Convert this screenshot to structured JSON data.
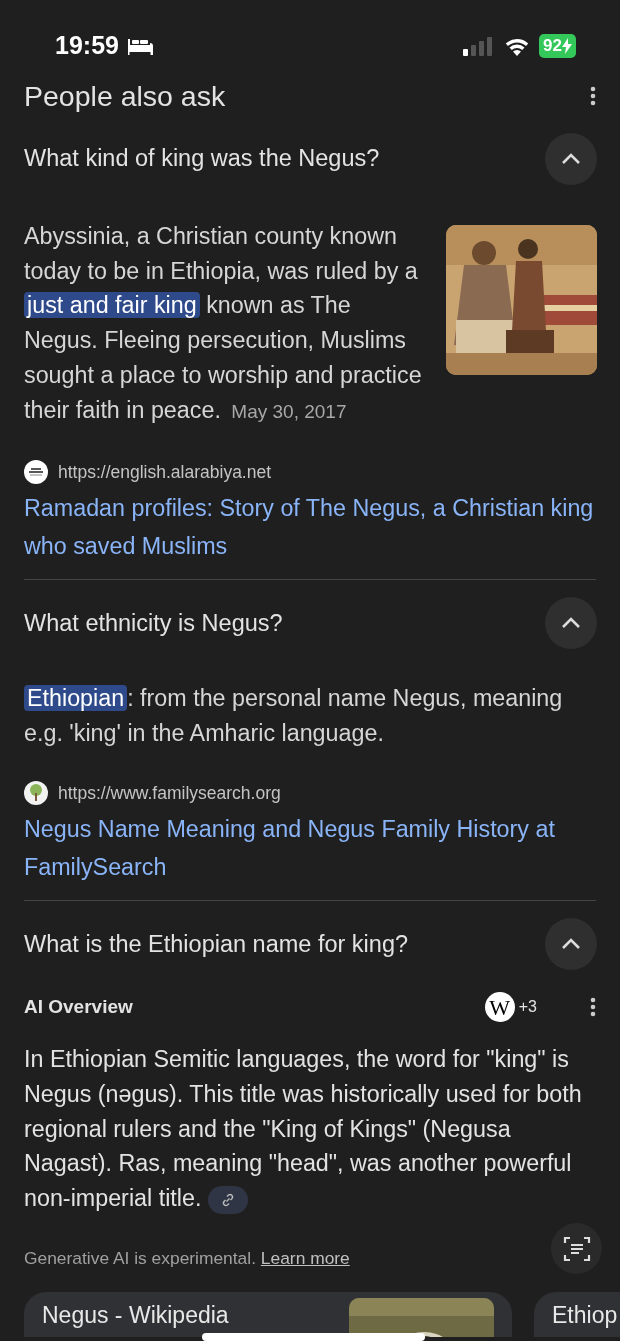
{
  "status_bar": {
    "time": "19:59",
    "battery": "92",
    "charging": true
  },
  "header": {
    "title": "People also ask"
  },
  "questions": [
    {
      "kind": "answer",
      "question": "What kind of king was the Negus?",
      "expanded": true,
      "segments": [
        {
          "text": "Abyssinia, a Christian county known today to be in Ethiopia, was ruled by a ",
          "highlighted": false
        },
        {
          "text": "just and fair king",
          "highlighted": true
        },
        {
          "text": " known as The Negus. Fleeing persecution, Muslims sought a place to worship and practice their faith in peace.",
          "highlighted": false
        }
      ],
      "date": "May 30, 2017",
      "source": {
        "url": "https://english.alarabiya.net",
        "title": "Ramadan profiles: Story of The Negus, a Christian king who saved Muslims"
      }
    },
    {
      "kind": "answer",
      "question": "What ethnicity is Negus?",
      "expanded": true,
      "segments": [
        {
          "text": "Ethiopian",
          "highlighted": true
        },
        {
          "text": ": from the personal name Negus, meaning e.g. 'king' in the Amharic language.",
          "highlighted": false
        }
      ],
      "source": {
        "url": "https://www.familysearch.org",
        "title": "Negus Name Meaning and Negus Family History at FamilySearch"
      }
    },
    {
      "kind": "ai_overview",
      "question": "What is the Ethiopian name for king?",
      "expanded": true,
      "label": "AI Overview",
      "logo": "W",
      "more_sources": "+3",
      "text": "In Ethiopian Semitic languages, the word for \"king\" is Negus (nəgus). This title was historically used for both regional rulers and the \"King of Kings\" (Negusa Nagast). Ras, meaning \"head\", was another powerful non-imperial title.",
      "disclaimer": "Generative AI is experimental.",
      "learn_more": "Learn more"
    }
  ],
  "cards": [
    {
      "title": "Negus - Wikipedia",
      "image": true
    },
    {
      "title": "Ethiop"
    }
  ]
}
